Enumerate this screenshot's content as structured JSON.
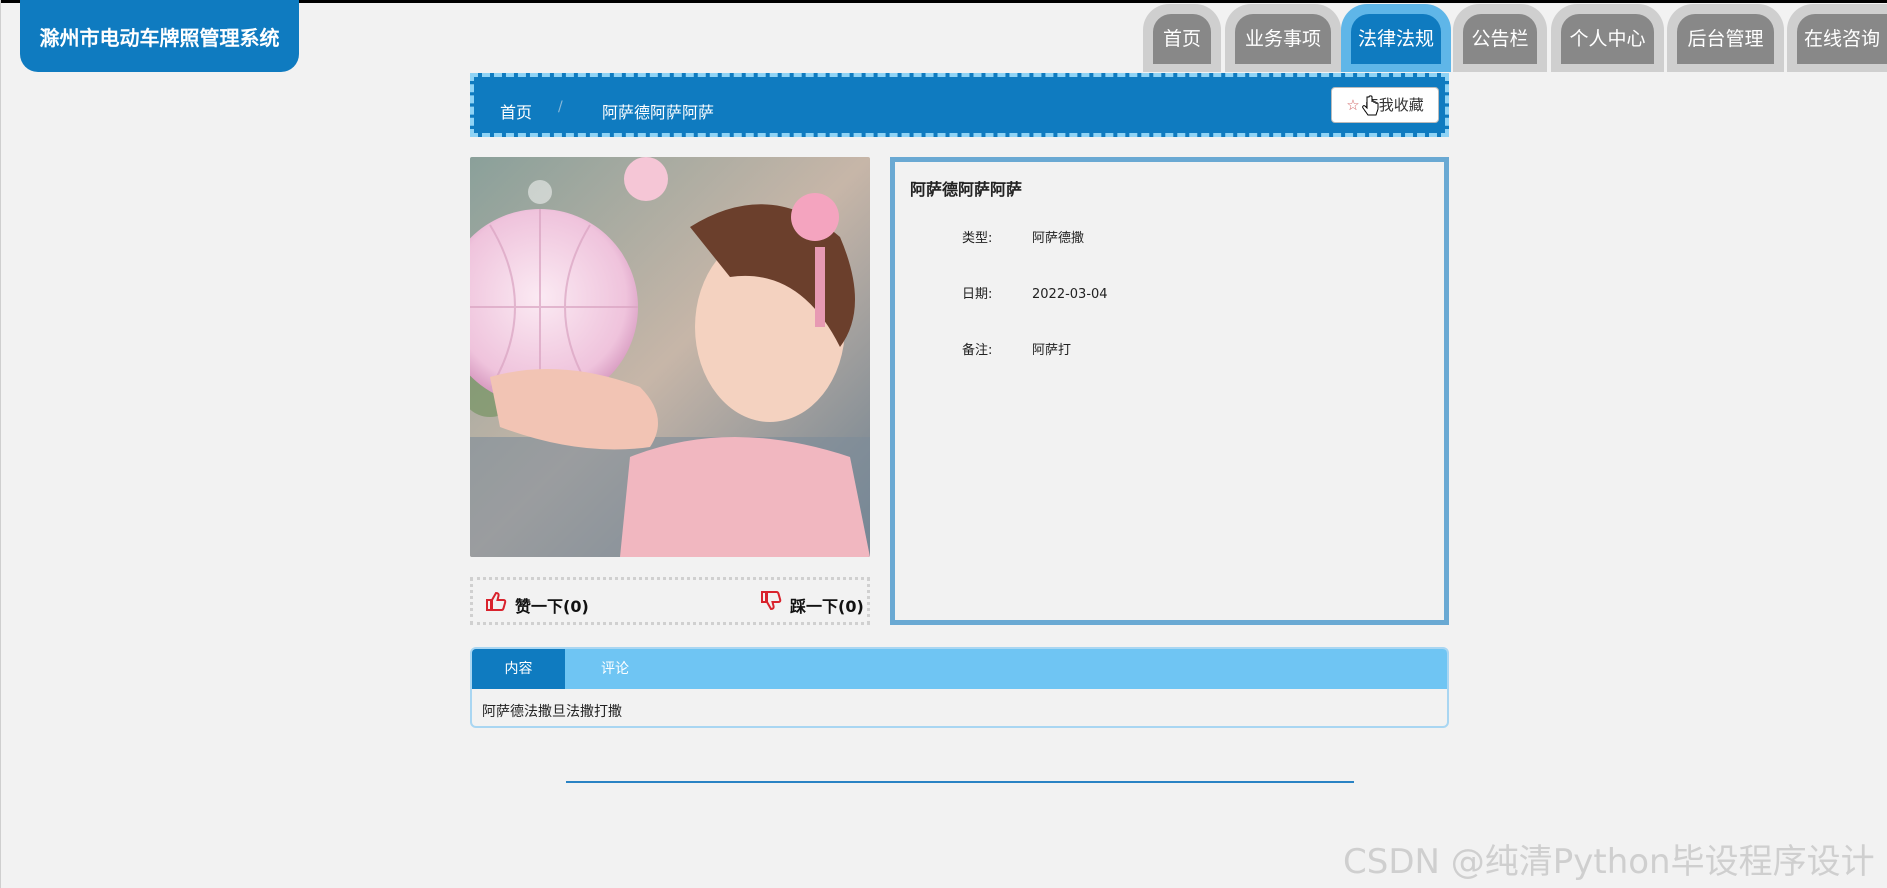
{
  "app": {
    "title": "滁州市电动车牌照管理系统"
  },
  "nav": {
    "items": [
      {
        "label": "首页",
        "active": false
      },
      {
        "label": "业务事项",
        "active": false
      },
      {
        "label": "法律法规",
        "active": true
      },
      {
        "label": "公告栏",
        "active": false
      },
      {
        "label": "个人中心",
        "active": false
      },
      {
        "label": "后台管理",
        "active": false
      },
      {
        "label": "在线咨询",
        "active": false
      }
    ]
  },
  "breadcrumb": {
    "home": "首页",
    "separator": "/",
    "current": "阿萨德阿萨阿萨"
  },
  "favorite": {
    "label": "点我收藏",
    "icon": "star-icon"
  },
  "vote": {
    "like_label": "赞一下(0)",
    "dislike_label": "踩一下(0)"
  },
  "detail": {
    "title": "阿萨德阿萨阿萨",
    "fields": [
      {
        "label": "类型:",
        "value": "阿萨德撒"
      },
      {
        "label": "日期:",
        "value": "2022-03-04"
      },
      {
        "label": "备注:",
        "value": "阿萨打"
      }
    ]
  },
  "tabs": {
    "items": [
      {
        "label": "内容",
        "active": true
      },
      {
        "label": "评论",
        "active": false
      }
    ],
    "content": "阿萨德法撒旦法撒打撒"
  },
  "watermark": "CSDN @纯清Python毕设程序设计",
  "colors": {
    "primary": "#0f7bc0",
    "light": "#6fc5f3",
    "border": "#6aa9d3"
  }
}
